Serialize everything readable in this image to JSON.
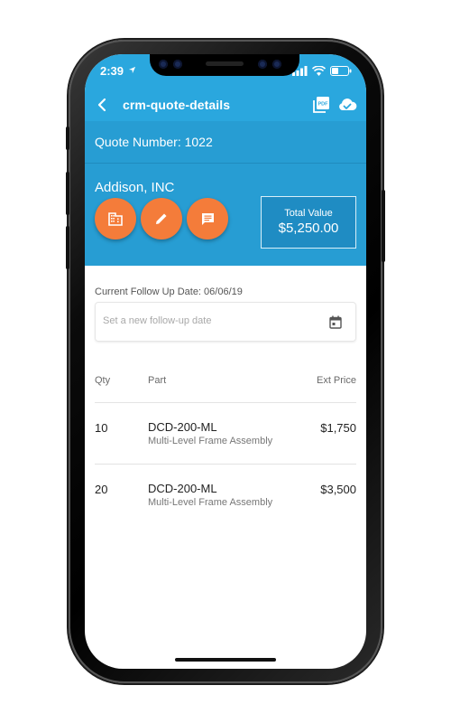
{
  "status_bar": {
    "time": "2:39"
  },
  "app_bar": {
    "title": "crm-quote-details",
    "pdf_icon_label": "PDF"
  },
  "quote": {
    "number_label": "Quote Number: 1022"
  },
  "customer": {
    "name": "Addison, INC",
    "total_label": "Total Value",
    "total_value": "$5,250.00"
  },
  "follow_up": {
    "current_label": "Current Follow Up Date:  06/06/19",
    "placeholder": "Set a new follow-up date"
  },
  "table": {
    "headers": {
      "qty": "Qty",
      "part": "Part",
      "price": "Ext Price"
    },
    "rows": [
      {
        "qty": "10",
        "part": "DCD-200-ML",
        "description": "Multi-Level Frame Assembly",
        "price": "$1,750"
      },
      {
        "qty": "20",
        "part": "DCD-200-ML",
        "description": "Multi-Level Frame Assembly",
        "price": "$3,500"
      }
    ]
  },
  "colors": {
    "primary": "#2aa7de",
    "header_panel": "#279dd3",
    "accent": "#f47c3a"
  },
  "icons": [
    "back-arrow-icon",
    "pdf-icon",
    "cloud-check-icon",
    "building-icon",
    "pencil-icon",
    "message-icon",
    "calendar-icon"
  ]
}
